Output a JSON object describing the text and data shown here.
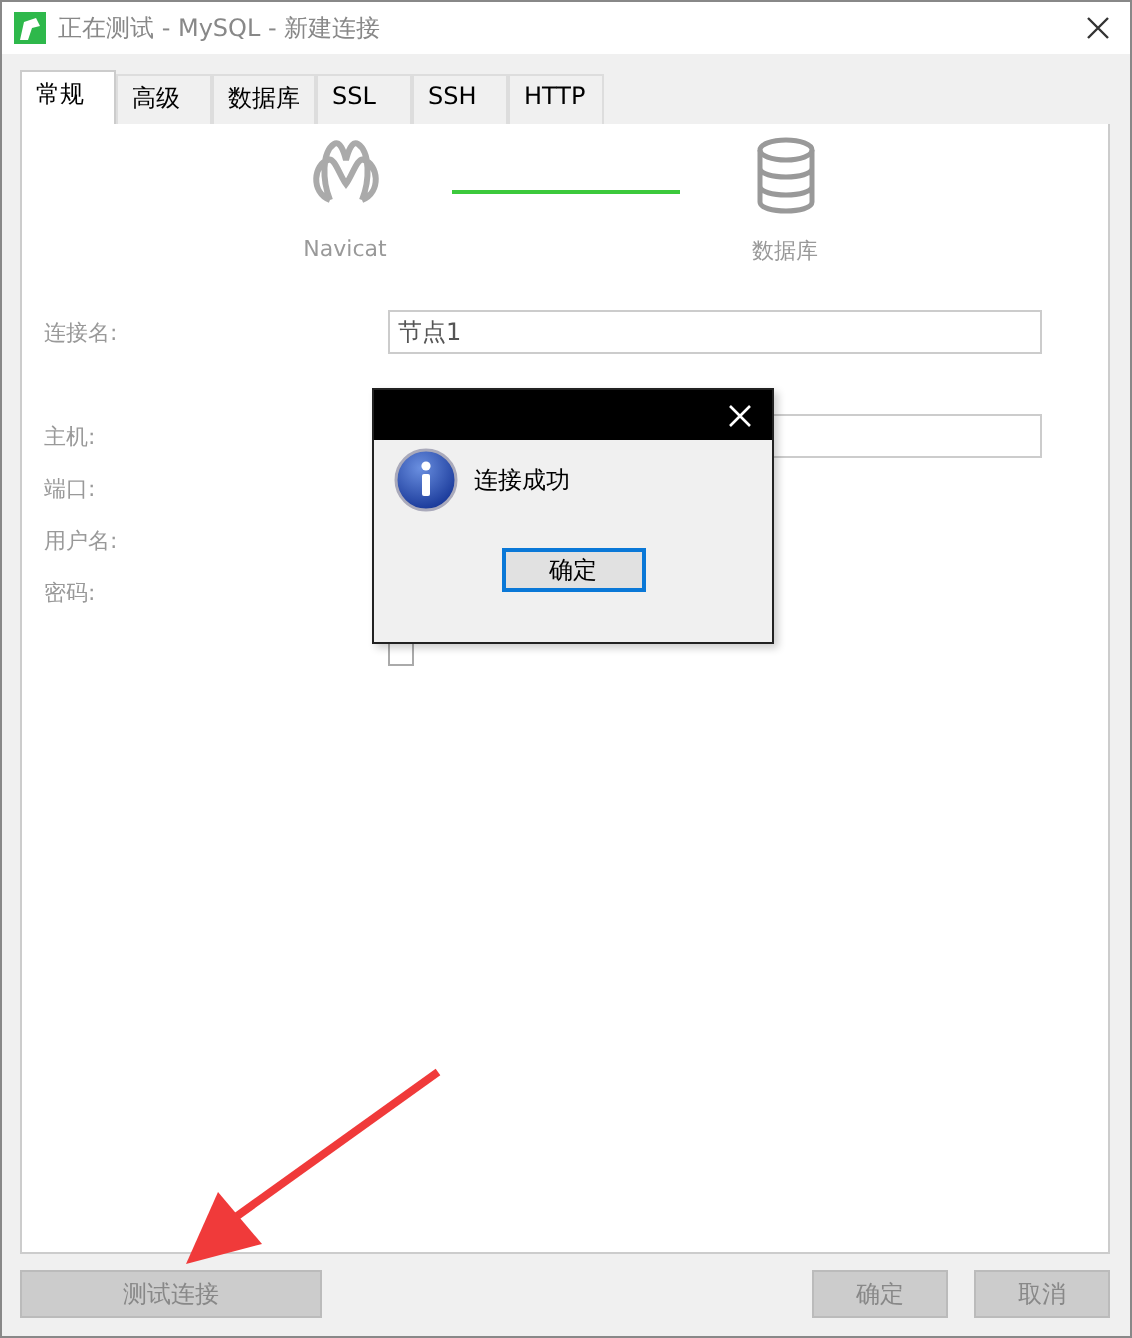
{
  "window": {
    "title": "正在测试 - MySQL - 新建连接"
  },
  "tabs": [
    {
      "label": "常规",
      "selected": true
    },
    {
      "label": "高级",
      "selected": false
    },
    {
      "label": "数据库",
      "selected": false
    },
    {
      "label": "SSL",
      "selected": false
    },
    {
      "label": "SSH",
      "selected": false
    },
    {
      "label": "HTTP",
      "selected": false
    }
  ],
  "diagram": {
    "left_label": "Navicat",
    "right_label": "数据库"
  },
  "form": [
    {
      "label": "连接名:",
      "kind": "field",
      "value": "节点1"
    },
    {
      "label": "主机:",
      "kind": "field"
    },
    {
      "label": "端口:",
      "kind": "plain"
    },
    {
      "label": "用户名:",
      "kind": "plain"
    },
    {
      "label": "密码:",
      "kind": "plain"
    }
  ],
  "save_password": {
    "checked": false
  },
  "buttons": [
    {
      "label": "测试连接",
      "kind": "left"
    },
    {
      "label": "确定",
      "kind": "right"
    },
    {
      "label": "取消",
      "kind": "right"
    }
  ],
  "message_box": {
    "message": "连接成功",
    "button": "确定"
  }
}
